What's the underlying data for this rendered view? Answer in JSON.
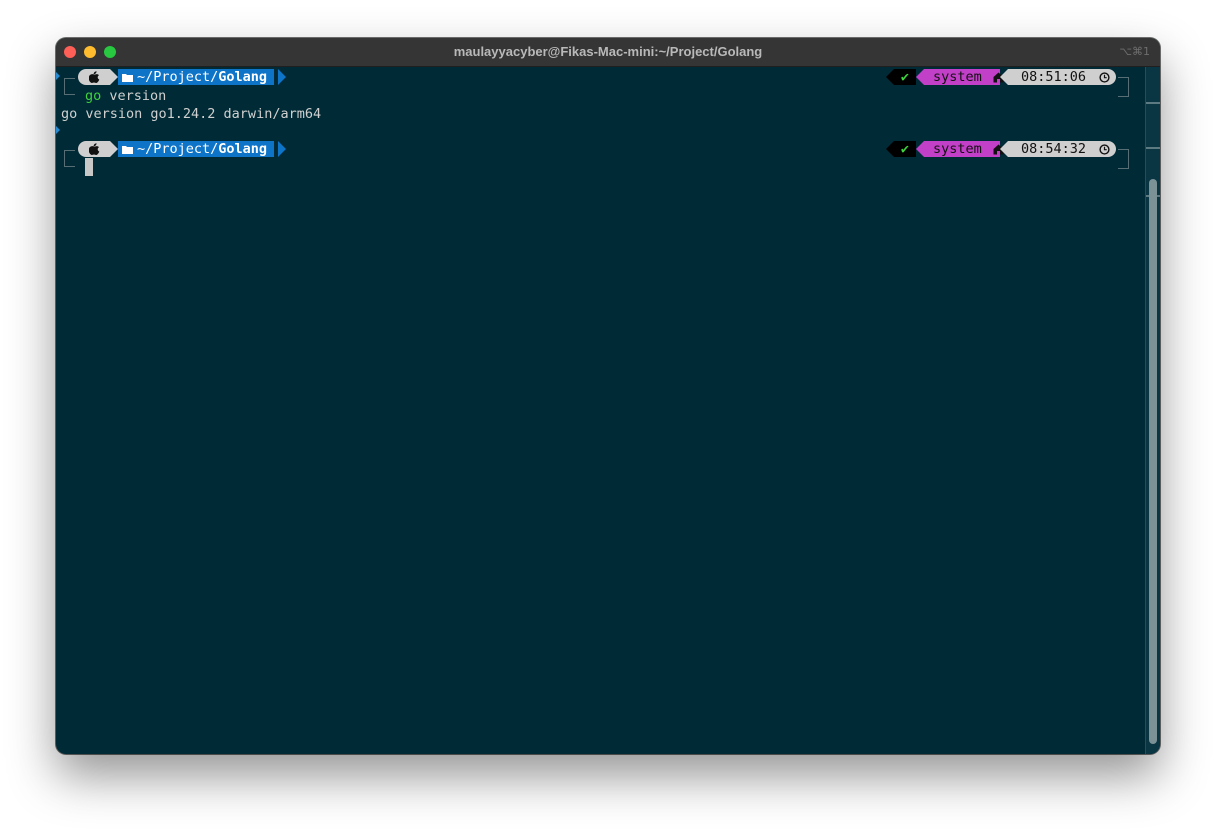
{
  "window": {
    "title": "maulayyacyber@Fikas-Mac-mini:~/Project/Golang",
    "shortcut": "⌥⌘1"
  },
  "prompts": [
    {
      "path_prefix": "~/Project/",
      "path_dir": "Golang",
      "status": "✔",
      "env": "system",
      "time": "08:51:06"
    },
    {
      "path_prefix": "~/Project/",
      "path_dir": "Golang",
      "status": "✔",
      "env": "system",
      "time": "08:54:32"
    }
  ],
  "session": {
    "command_name": "go",
    "command_args": " version",
    "output": "go version go1.24.2 darwin/arm64"
  },
  "colors": {
    "background": "#002b36",
    "path_segment": "#0d74c8",
    "env_segment": "#c23fc7",
    "status_ok": "#3fd13f"
  },
  "icons": {
    "os": "apple-icon",
    "folder": "folder-icon",
    "env": "home-icon",
    "time": "clock-icon"
  }
}
